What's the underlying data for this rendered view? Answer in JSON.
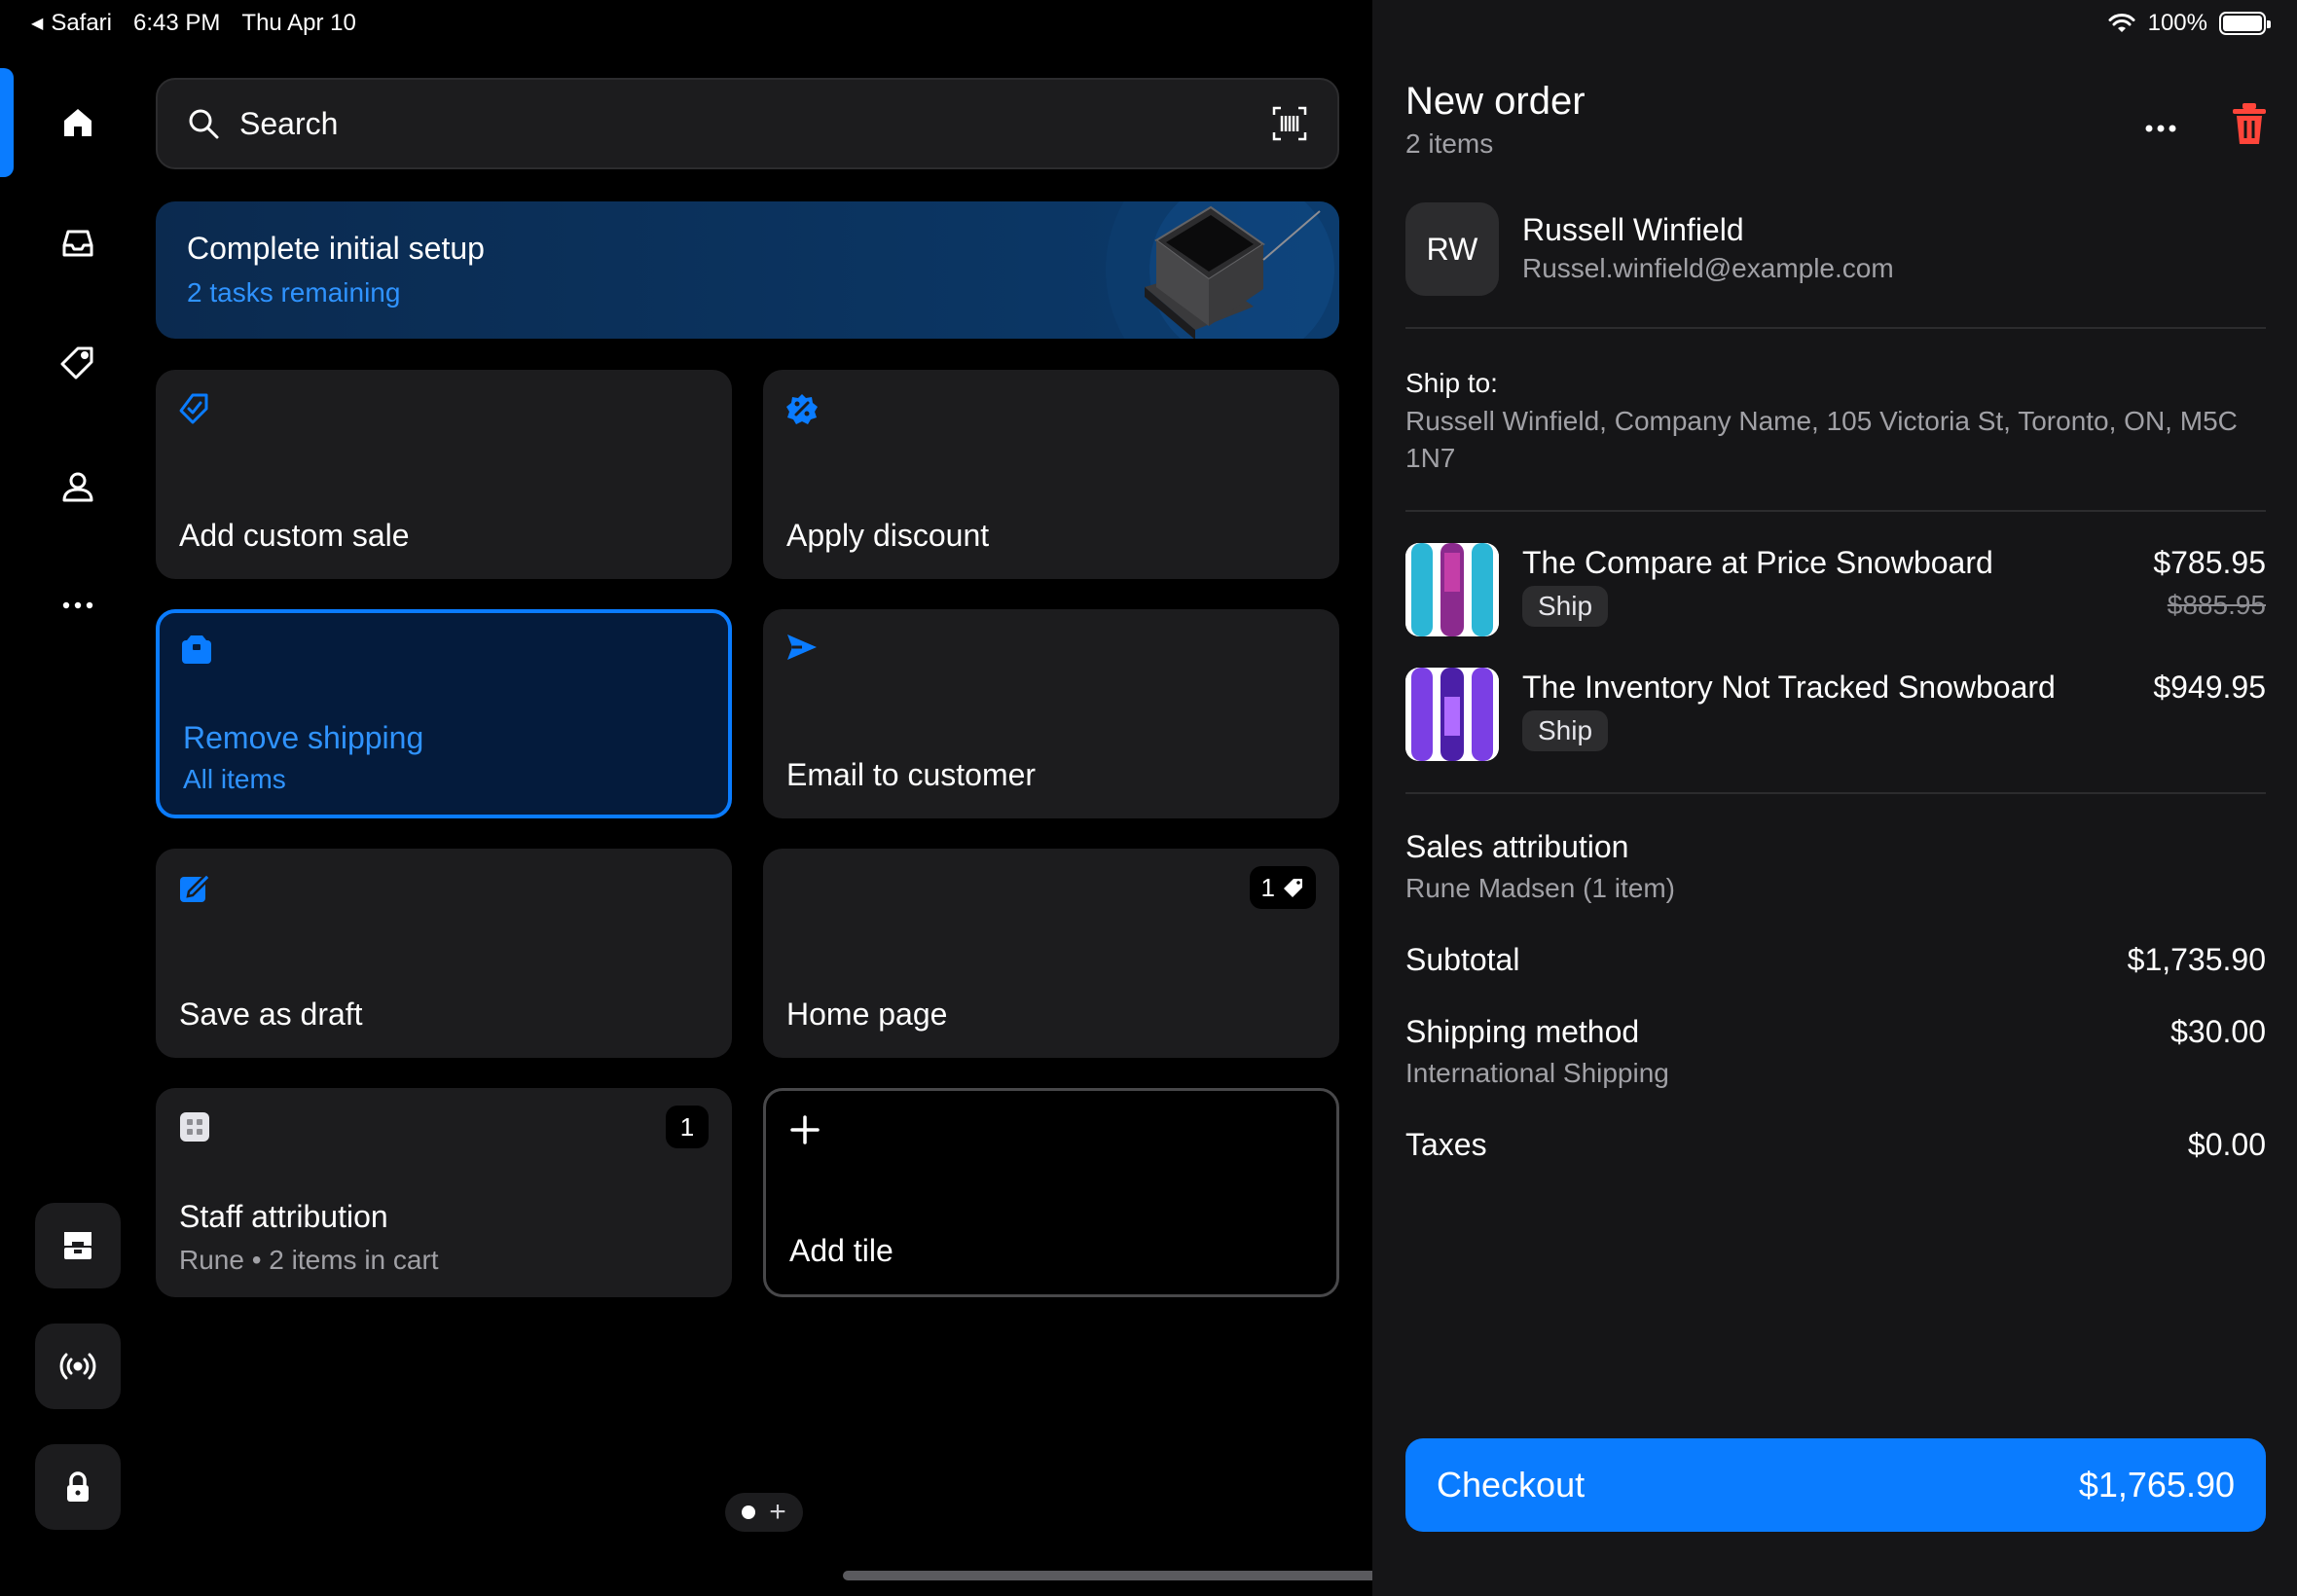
{
  "status_bar": {
    "app": "Safari",
    "time": "6:43 PM",
    "date": "Thu Apr 10",
    "battery": "100%"
  },
  "rail": {
    "items": [
      {
        "icon": "home-icon",
        "active": true
      },
      {
        "icon": "inbox-icon",
        "active": false
      },
      {
        "icon": "tag-icon",
        "active": false
      },
      {
        "icon": "person-icon",
        "active": false
      },
      {
        "icon": "more-icon",
        "active": false
      }
    ],
    "bottom": [
      "store-icon",
      "broadcast-icon",
      "lock-icon"
    ]
  },
  "search": {
    "placeholder": "Search"
  },
  "banner": {
    "title": "Complete initial setup",
    "subtitle": "2 tasks remaining"
  },
  "tiles": {
    "custom_sale": {
      "title": "Add custom sale"
    },
    "discount": {
      "title": "Apply discount"
    },
    "remove_shipping": {
      "title": "Remove shipping",
      "subtitle": "All items"
    },
    "email": {
      "title": "Email to customer"
    },
    "draft": {
      "title": "Save as draft"
    },
    "home_page": {
      "title": "Home page",
      "badge": "1"
    },
    "staff": {
      "title": "Staff attribution",
      "subtitle": "Rune • 2 items in cart",
      "badge": "1"
    },
    "add_tile": {
      "title": "Add tile"
    }
  },
  "order": {
    "title": "New order",
    "count": "2 items",
    "customer": {
      "initials": "RW",
      "name": "Russell Winfield",
      "email": "Russel.winfield@example.com"
    },
    "ship_to_label": "Ship to:",
    "ship_to_address": "Russell Winfield, Company Name, 105 Victoria St, Toronto, ON, M5C 1N7",
    "items": [
      {
        "name": "The Compare at Price Snowboard",
        "tag": "Ship",
        "price": "$785.95",
        "compare_price": "$885.95"
      },
      {
        "name": "The Inventory Not Tracked Snowboard",
        "tag": "Ship",
        "price": "$949.95"
      }
    ],
    "sales_attribution": {
      "label": "Sales attribution",
      "value": "Rune Madsen (1 item)"
    },
    "subtotal": {
      "label": "Subtotal",
      "value": "$1,735.90"
    },
    "shipping": {
      "label": "Shipping method",
      "method": "International Shipping",
      "value": "$30.00"
    },
    "taxes": {
      "label": "Taxes",
      "value": "$0.00"
    },
    "checkout": {
      "label": "Checkout",
      "total": "$1,765.90"
    }
  },
  "colors": {
    "accent": "#0a7cff",
    "danger": "#ff453a",
    "panel": "#151517",
    "tile": "#1c1c1e"
  }
}
